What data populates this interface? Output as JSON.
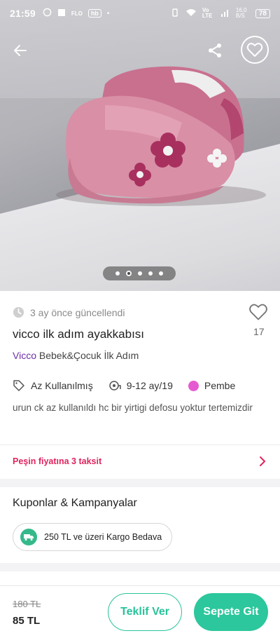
{
  "status_bar": {
    "time": "21:59",
    "left_chips": [
      "FLO",
      "hb"
    ],
    "network_label": "Vo LTE",
    "speed": "16,0 B/S",
    "battery": "78"
  },
  "gallery": {
    "image_description_icon": "shoe-photo",
    "dots_count": 5,
    "active_index": 1
  },
  "product": {
    "updated_text": "3 ay önce güncellendi",
    "like_count": "17",
    "title": "vicco ilk adım ayakkabısı",
    "brand": "Vicco",
    "category": "Bebek&Çocuk İlk Adım",
    "condition": "Az Kullanılmış",
    "size": "9-12 ay/19",
    "color_name": "Pembe",
    "color_hex": "#e55ad0",
    "description": "urun ck az kullanıldı hc bir yirtigi defosu yoktur tertemizdir"
  },
  "installment": {
    "text": "Peşin fiyatına 3 taksit"
  },
  "coupons": {
    "section_title": "Kuponlar & Kampanyalar",
    "items": [
      {
        "label": "250 TL ve üzeri Kargo Bedava",
        "icon": "truck-icon"
      }
    ]
  },
  "bottom_bar": {
    "old_price": "180 TL",
    "price": "85 TL",
    "offer_label": "Teklif Ver",
    "cart_label": "Sepete Git"
  },
  "colors": {
    "accent_green": "#2cc79c",
    "accent_pink": "#e0245e",
    "brand_purple": "#6b2fa6"
  }
}
